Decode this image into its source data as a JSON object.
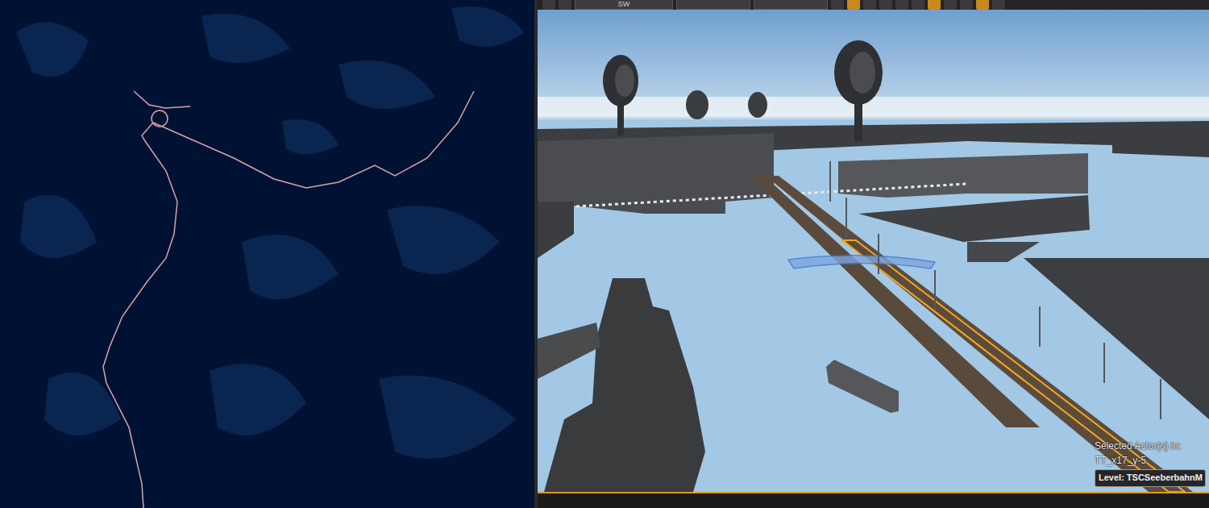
{
  "toolbar": {
    "fields": [
      "SW"
    ]
  },
  "viewport": {
    "overlay": {
      "label": "Selected Actor(s) in:",
      "actor_level": "TT_x17_y-5",
      "level_badge": "Level: TSCSeeberbahnM"
    }
  }
}
